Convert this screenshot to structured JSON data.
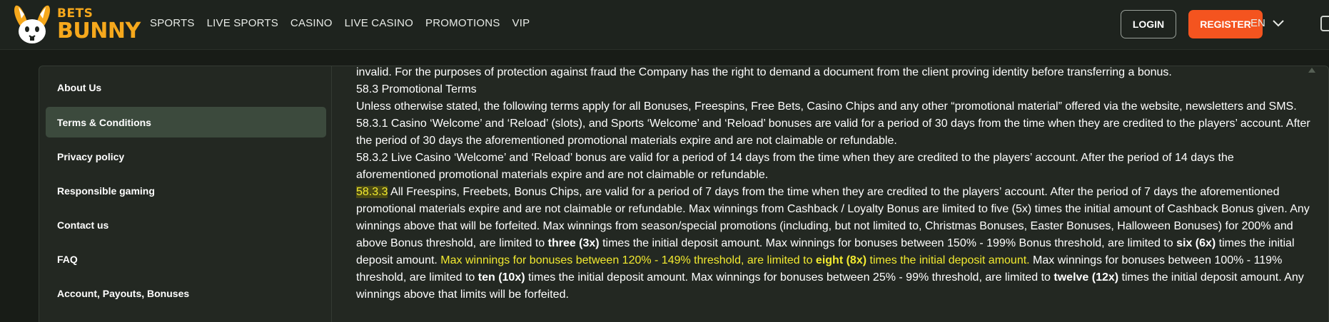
{
  "header": {
    "logo": {
      "top": "BETS",
      "bottom": "BUNNY"
    },
    "nav": [
      "SPORTS",
      "LIVE SPORTS",
      "CASINO",
      "LIVE CASINO",
      "PROMOTIONS",
      "VIP"
    ],
    "login_label": "LOGIN",
    "register_label": "REGISTER",
    "language": "EN"
  },
  "colors": {
    "accent": "#f4541f",
    "brand": "#f6a81c",
    "highlight": "#f2ea30"
  },
  "sidebar": {
    "items": [
      {
        "label": "About Us",
        "active": false
      },
      {
        "label": "Terms & Conditions",
        "active": true
      },
      {
        "label": "Privacy policy",
        "active": false
      },
      {
        "label": "Responsible gaming",
        "active": false
      },
      {
        "label": "Contact us",
        "active": false
      },
      {
        "label": "FAQ",
        "active": false
      },
      {
        "label": "Account, Payouts, Bonuses",
        "active": false
      }
    ]
  },
  "content": {
    "p0": "invalid. For the purposes of protection against fraud the Company has the right to demand a document from the client proving identity before transferring a bonus.",
    "p1": "58.3 Promotional Terms",
    "p2": "Unless otherwise stated, the following terms apply for all Bonuses, Freespins, Free Bets, Casino Chips and any other “promotional material” offered via the website, newsletters and SMS.",
    "p3": "58.3.1 Casino ‘Welcome’ and ‘Reload’ (slots), and Sports ‘Welcome’ and ‘Reload’ bonuses are valid for a period of 30 days from the time when they are credited to the players’ account. After the period of 30 days the aforementioned promotional materials expire and are not claimable or refundable.",
    "p4": "58.3.2 Live Casino ‘Welcome’ and ‘Reload’ bonus are valid for a period of 14 days from the time when they are credited to the players’ account. After the period of 14 days the aforementioned promotional materials expire and are not claimable or refundable.",
    "p5": {
      "num": "58.3.3",
      "t1": " All Freespins, Freebets, Bonus Chips, are valid for a period of 7 days from the time when they are credited to the players’ account. After the period of 7 days the aforementioned promotional materials expire and are not claimable or refundable. Max winnings from Cashback / Loyalty Bonus are limited to five (5x) times the initial amount of Cashback Bonus given. Any winnings above that will be forfeited. Max winnings from season/special promotions (including, but not limited to, Christmas Bonuses, Easter Bonuses, Halloween Bonuses) for 200% and above Bonus threshold, are limited to ",
      "b1": "three (3x)",
      "t2": " times the initial deposit amount. Max winnings for bonuses between 150% - 199% Bonus threshold, are limited to ",
      "b2": "six (6x)",
      "t3": " times the initial deposit amount. ",
      "h1": "Max winnings for bonuses between 120% - 149% threshold, are limited to ",
      "hb": "eight (8x)",
      "h2": " times the initial deposit amount.",
      "t4": " Max winnings for bonuses between 100% - 119% threshold, are limited to ",
      "b3": "ten (10x)",
      "t5": " times the initial deposit amount. Max winnings for bonuses between 25% - 99% threshold, are limited to ",
      "b4": "twelve (12x)",
      "t6": " times the initial deposit amount. Any winnings above that limits will be forfeited."
    }
  }
}
